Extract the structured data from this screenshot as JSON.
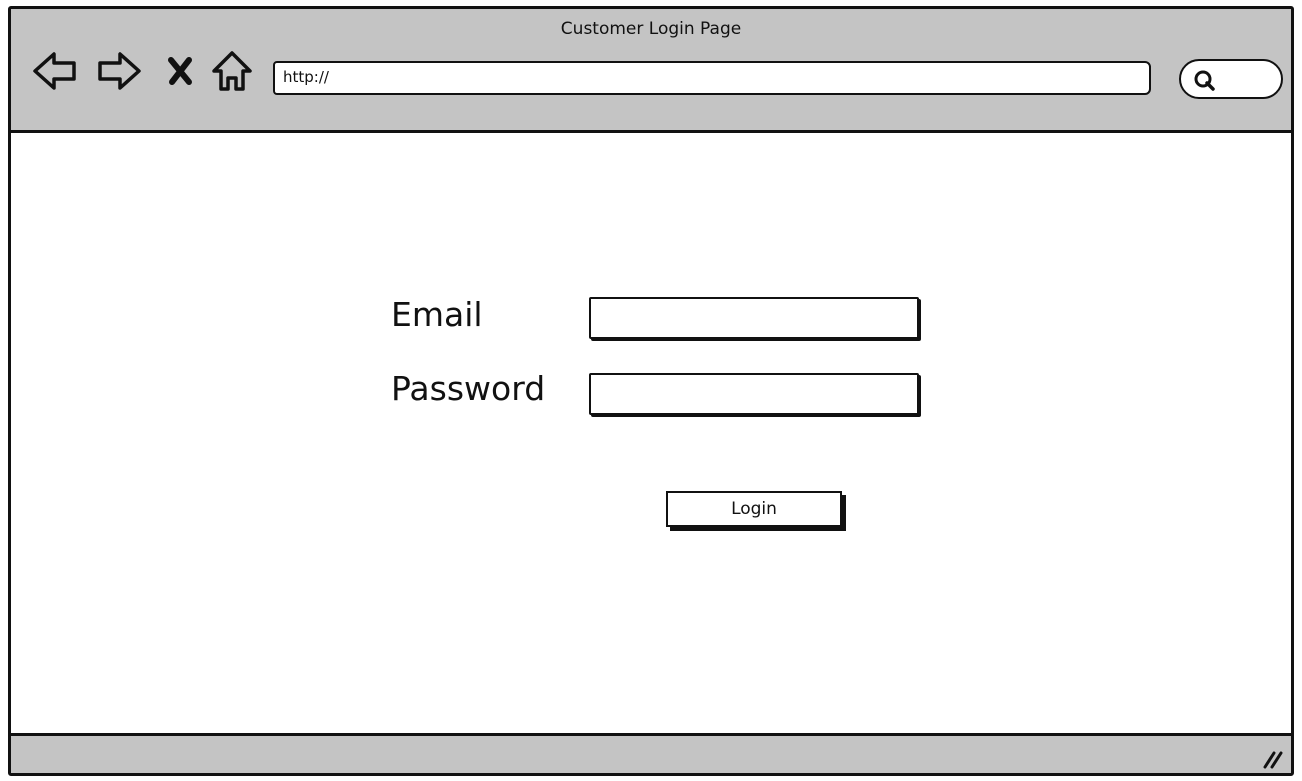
{
  "window": {
    "title": "Customer Login Page"
  },
  "toolbar": {
    "back_icon": "arrow-left-icon",
    "forward_icon": "arrow-right-icon",
    "stop_icon": "close-icon",
    "home_icon": "home-icon",
    "url_value": "http://",
    "search_icon": "search-icon"
  },
  "login_form": {
    "email_label": "Email",
    "email_value": "",
    "password_label": "Password",
    "password_value": "",
    "submit_label": "Login"
  },
  "colors": {
    "chrome_background": "#c4c4c4",
    "stroke": "#111111",
    "page_background": "#ffffff"
  }
}
